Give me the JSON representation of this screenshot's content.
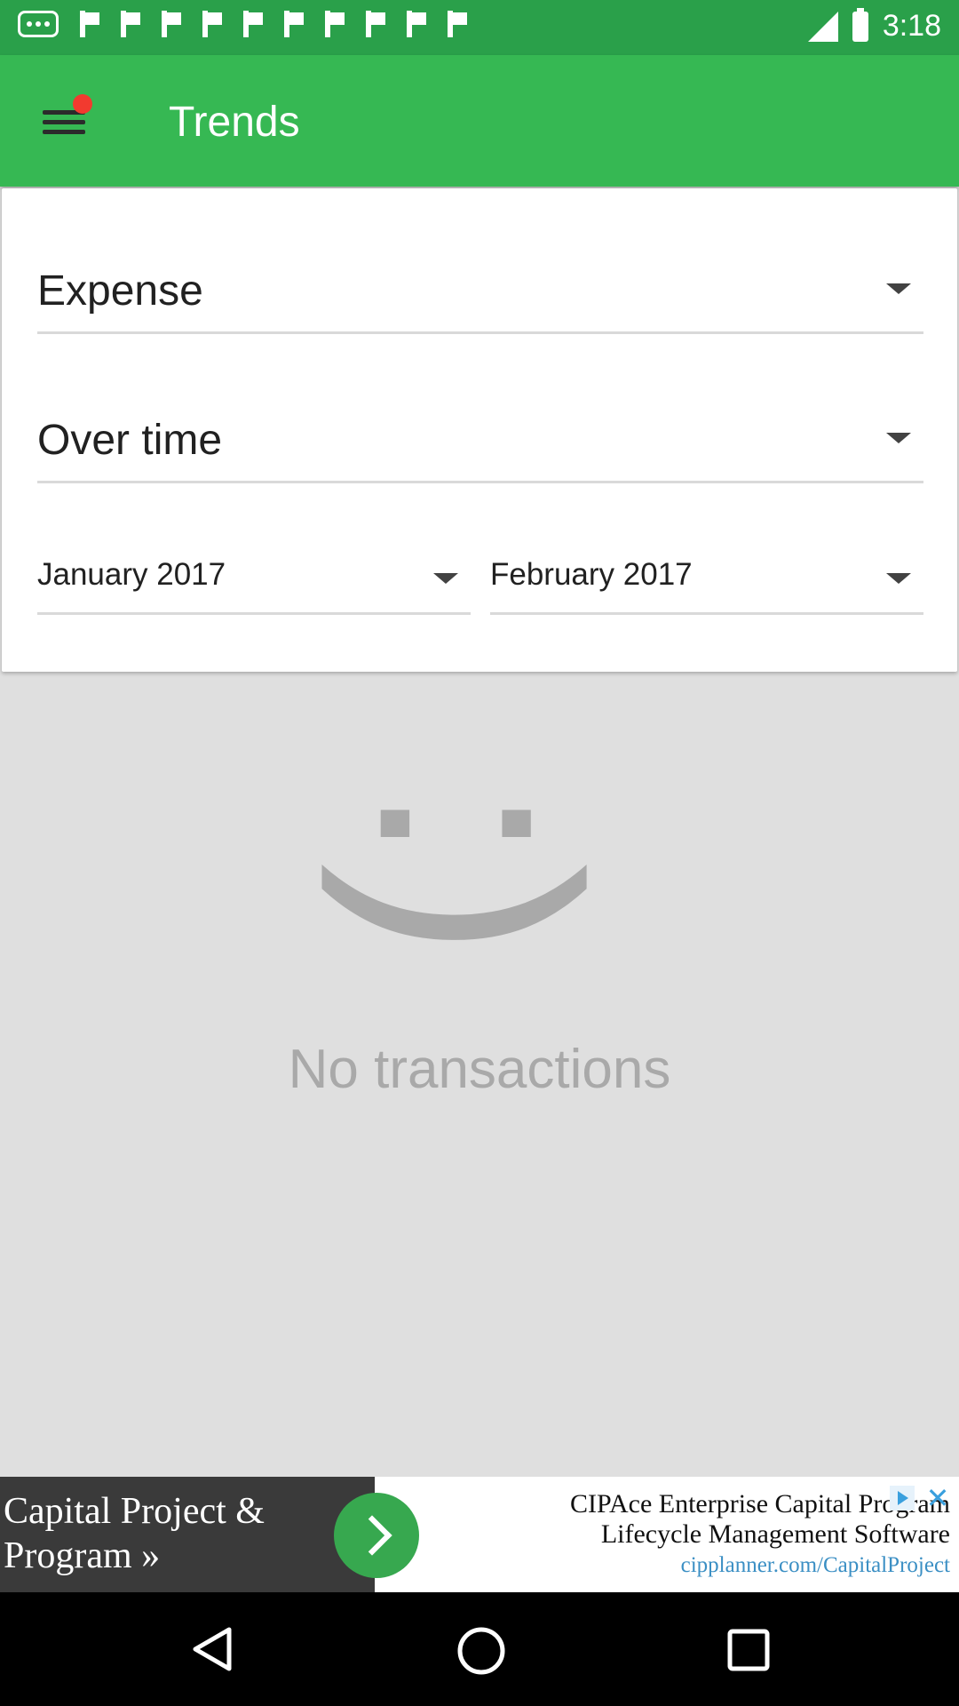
{
  "status_bar": {
    "time": "3:18",
    "icons": [
      "more-dots-icon",
      "notification-flag-icon",
      "signal-icon",
      "battery-icon"
    ]
  },
  "app_bar": {
    "title": "Trends",
    "menu_icon": "hamburger-menu-icon",
    "has_notification_dot": true,
    "colors": {
      "app_bar": "#36b853",
      "status_bar": "#2aa04a",
      "notification_dot": "#f23a2f"
    }
  },
  "filters": {
    "type": {
      "selected": "Expense"
    },
    "mode": {
      "selected": "Over time"
    },
    "from": {
      "selected": "January 2017"
    },
    "to": {
      "selected": "February 2017"
    }
  },
  "empty_state": {
    "emoticon": ":)",
    "message": "No transactions"
  },
  "ad": {
    "left_title": "Capital Project & Program »",
    "line1": "CIPAce Enterprise Capital Program",
    "line2": "Lifecycle Management Software",
    "url": "cipplanner.com/CapitalProject",
    "icons": [
      "adchoices-icon",
      "close-icon",
      "chevron-right-icon"
    ]
  },
  "nav_bar": {
    "icons": [
      "back-icon",
      "home-icon",
      "recents-icon"
    ]
  }
}
